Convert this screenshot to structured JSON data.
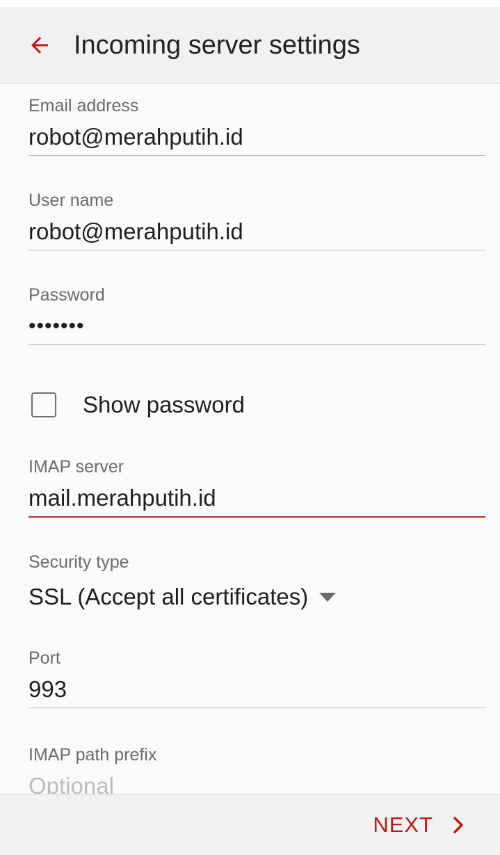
{
  "app_bar": {
    "title": "Incoming server settings",
    "back_icon": "arrow-left-icon"
  },
  "fields": {
    "email": {
      "label": "Email address",
      "value": "robot@merahputih.id"
    },
    "username": {
      "label": "User name",
      "value": "robot@merahputih.id"
    },
    "password": {
      "label": "Password",
      "value": "•••••••"
    },
    "show_password": {
      "label": "Show password",
      "checked": false
    },
    "imap_server": {
      "label": "IMAP server",
      "value": "mail.merahputih.id"
    },
    "security_type": {
      "label": "Security type",
      "value": "SSL (Accept all certificates)",
      "icon": "dropdown-arrow-icon"
    },
    "port": {
      "label": "Port",
      "value": "993"
    },
    "imap_path_prefix": {
      "label": "IMAP path prefix",
      "placeholder": "Optional"
    }
  },
  "footer": {
    "next_label": "NEXT",
    "next_icon": "chevron-right-icon"
  },
  "colors": {
    "accent": "#c62828",
    "background": "#fafafa",
    "bar_background": "#f1f1f1"
  }
}
